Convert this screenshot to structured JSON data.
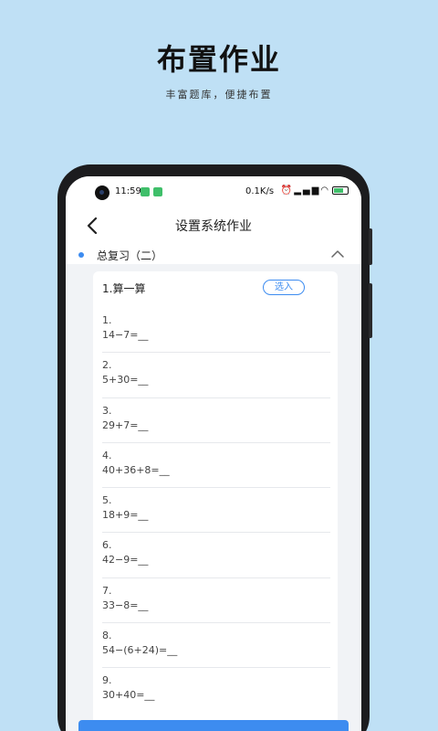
{
  "promo": {
    "title": "布置作业",
    "subtitle": "丰富题库，便捷布置"
  },
  "status_bar": {
    "time": "11:59",
    "network_speed": "0.1K/s",
    "icons": [
      "alarm-icon",
      "signal-icon",
      "wifi-icon",
      "battery-icon"
    ]
  },
  "app_bar": {
    "title": "设置系统作业",
    "back_icon": "chevron-left-icon"
  },
  "section": {
    "label": "总复习（二）",
    "expand_icon": "chevron-up-icon"
  },
  "card": {
    "title": "1.算一算",
    "select_label": "选入",
    "questions": [
      {
        "num": "1.",
        "expr": "14−7=__"
      },
      {
        "num": "2.",
        "expr": "5+30=__"
      },
      {
        "num": "3.",
        "expr": "29+7=__"
      },
      {
        "num": "4.",
        "expr": "40+36+8=__"
      },
      {
        "num": "5.",
        "expr": "18+9=__"
      },
      {
        "num": "6.",
        "expr": "42−9=__"
      },
      {
        "num": "7.",
        "expr": "33−8=__"
      },
      {
        "num": "8.",
        "expr": "54−(6+24)=__"
      },
      {
        "num": "9.",
        "expr": "30+40=__"
      }
    ]
  },
  "colors": {
    "background": "#bfe0f5",
    "accent": "#3d8cf0",
    "phone_frame": "#1c1c1e"
  }
}
